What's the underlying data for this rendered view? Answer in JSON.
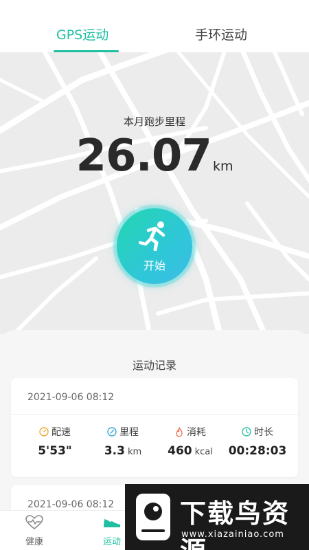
{
  "tabs": {
    "gps": "GPS运动",
    "band": "手环运动"
  },
  "summary": {
    "label": "本月跑步里程",
    "value": "26.07",
    "unit": "km"
  },
  "start_button": {
    "label": "开始",
    "icon": "running-person-icon"
  },
  "records": {
    "title": "运动记录",
    "items": [
      {
        "date": "2021-09-06  08:12",
        "stats": [
          {
            "label": "配速",
            "value": "5'53\"",
            "unit": "",
            "icon": "pace-icon",
            "color": "#f0a830"
          },
          {
            "label": "里程",
            "value": "3.3",
            "unit": "km",
            "icon": "distance-icon",
            "color": "#3aa7d8"
          },
          {
            "label": "消耗",
            "value": "460",
            "unit": "kcal",
            "icon": "flame-icon",
            "color": "#ef6b4d"
          },
          {
            "label": "时长",
            "value": "00:28:03",
            "unit": "",
            "icon": "clock-icon",
            "color": "#2ec4a6"
          }
        ]
      },
      {
        "date": "2021-09-06  08:12"
      }
    ]
  },
  "nav": {
    "health": "健康",
    "sport": "运动"
  },
  "watermark": {
    "title": "下载鸟资源",
    "url": "www.xiazainiao.com"
  },
  "colors": {
    "accent": "#1fbfa2",
    "map_bg": "#ececec"
  }
}
